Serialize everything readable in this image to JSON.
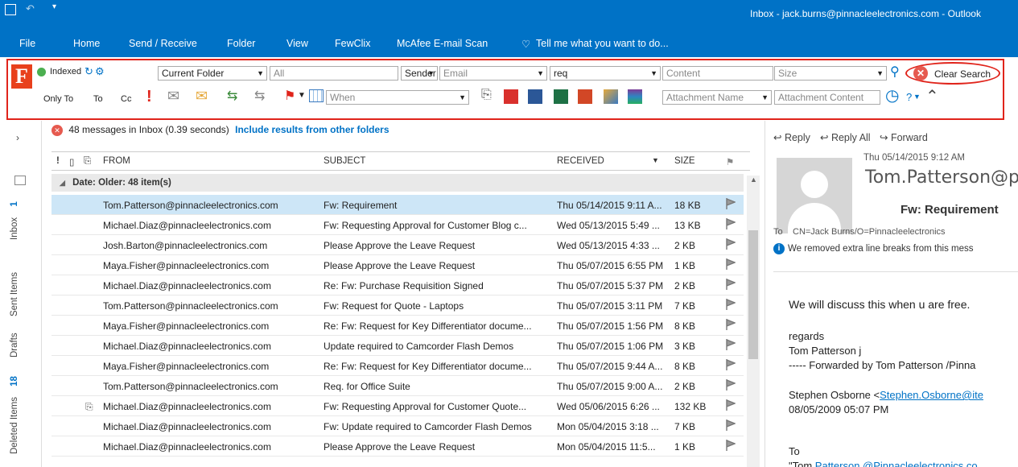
{
  "titlebar": {
    "title": "Inbox - jack.burns@pinnacleelectronics.com - Outlook"
  },
  "menu": [
    "File",
    "Home",
    "Send / Receive",
    "Folder",
    "View",
    "FewClix",
    "McAfee E-mail Scan",
    "Tell me what you want to do..."
  ],
  "fewclix": {
    "indexed_label": "Indexed",
    "current_folder": "Current Folder",
    "all_placeholder": "All",
    "sender": "Sender",
    "email_placeholder": "Email",
    "req_value": "req",
    "content_placeholder": "Content",
    "size_placeholder": "Size",
    "clear_search": "Clear Search",
    "only_to": "Only To",
    "to": "To",
    "cc": "Cc",
    "when_placeholder": "When",
    "attachment_name": "Attachment Name",
    "attachment_content": "Attachment Content",
    "help": "?"
  },
  "leftnav": {
    "inbox": "Inbox",
    "inbox_count": "1",
    "sent": "Sent Items",
    "drafts": "Drafts",
    "deleted": "Deleted Items",
    "deleted_count": "18"
  },
  "list": {
    "status": "48 messages in Inbox (0.39 seconds)",
    "include_link": "Include results from other folders",
    "headers": {
      "importance": "!",
      "from": "FROM",
      "subject": "SUBJECT",
      "received": "RECEIVED",
      "size": "SIZE"
    },
    "group": "Date: Older: 48 item(s)",
    "rows": [
      {
        "from": "Tom.Patterson@pinnacleelectronics.com",
        "subject": "Fw: Requirement",
        "received": "Thu 05/14/2015 9:11 A...",
        "size": "18 KB",
        "attach": ""
      },
      {
        "from": "Michael.Diaz@pinnacleelectronics.com",
        "subject": "Fw: Requesting Approval for Customer Blog c...",
        "received": "Wed 05/13/2015 5:49 ...",
        "size": "13 KB",
        "attach": ""
      },
      {
        "from": "Josh.Barton@pinnacleelectronics.com",
        "subject": "Please Approve the Leave Request",
        "received": "Wed 05/13/2015 4:33 ...",
        "size": "2 KB",
        "attach": ""
      },
      {
        "from": "Maya.Fisher@pinnacleelectronics.com",
        "subject": "Please Approve the Leave Request",
        "received": "Thu 05/07/2015 6:55 PM",
        "size": "1 KB",
        "attach": ""
      },
      {
        "from": "Michael.Diaz@pinnacleelectronics.com",
        "subject": "Re: Fw: Purchase Requisition Signed",
        "received": "Thu 05/07/2015 5:37 PM",
        "size": "2 KB",
        "attach": ""
      },
      {
        "from": "Tom.Patterson@pinnacleelectronics.com",
        "subject": "Fw: Request for Quote - Laptops",
        "received": "Thu 05/07/2015 3:11 PM",
        "size": "7 KB",
        "attach": ""
      },
      {
        "from": "Maya.Fisher@pinnacleelectronics.com",
        "subject": "Re: Fw: Request for Key Differentiator docume...",
        "received": "Thu 05/07/2015 1:56 PM",
        "size": "8 KB",
        "attach": ""
      },
      {
        "from": "Michael.Diaz@pinnacleelectronics.com",
        "subject": "Update required to Camcorder Flash Demos",
        "received": "Thu 05/07/2015 1:06 PM",
        "size": "3 KB",
        "attach": ""
      },
      {
        "from": "Maya.Fisher@pinnacleelectronics.com",
        "subject": "Re: Fw: Request for Key Differentiator docume...",
        "received": "Thu 05/07/2015 9:44 A...",
        "size": "8 KB",
        "attach": ""
      },
      {
        "from": "Tom.Patterson@pinnacleelectronics.com",
        "subject": "Req. for Office Suite",
        "received": "Thu 05/07/2015 9:00 A...",
        "size": "2 KB",
        "attach": ""
      },
      {
        "from": "Michael.Diaz@pinnacleelectronics.com",
        "subject": "Fw: Requesting Approval for Customer Quote...",
        "received": "Wed 05/06/2015 6:26 ...",
        "size": "132 KB",
        "attach": "0"
      },
      {
        "from": "Michael.Diaz@pinnacleelectronics.com",
        "subject": "Fw: Update required to Camcorder Flash Demos",
        "received": "Mon 05/04/2015 3:18 ...",
        "size": "7 KB",
        "attach": ""
      },
      {
        "from": "Michael.Diaz@pinnacleelectronics.com",
        "subject": "Please Approve the Leave Request",
        "received": "Mon 05/04/2015 11:5...",
        "size": "1 KB",
        "attach": ""
      }
    ]
  },
  "reading": {
    "reply": "Reply",
    "reply_all": "Reply All",
    "forward": "Forward",
    "date": "Thu 05/14/2015 9:12 AM",
    "sender": "Tom.Patterson@p",
    "subject": "Fw: Requirement",
    "to_label": "To",
    "to_value": "CN=Jack Burns/O=Pinnacleelectronics",
    "info": "We removed extra line breaks from this mess",
    "body1": "We will discuss this when u are free.",
    "body2": "regards",
    "body3": "Tom Patterson j",
    "body4": "----- Forwarded by Tom Patterson /Pinna",
    "body5": "Stephen Osborne <",
    "body5_link": "Stephen.Osborne@ite",
    "body6": "08/05/2009 05:07 PM",
    "body7": "To",
    "body8": "\"Tom ",
    "body8_link": "Patterson @Pinnacleelectronics.co"
  },
  "colors": {
    "accent": "#0072c6",
    "highlight": "#e0241b",
    "selected_row": "#cde6f7"
  }
}
